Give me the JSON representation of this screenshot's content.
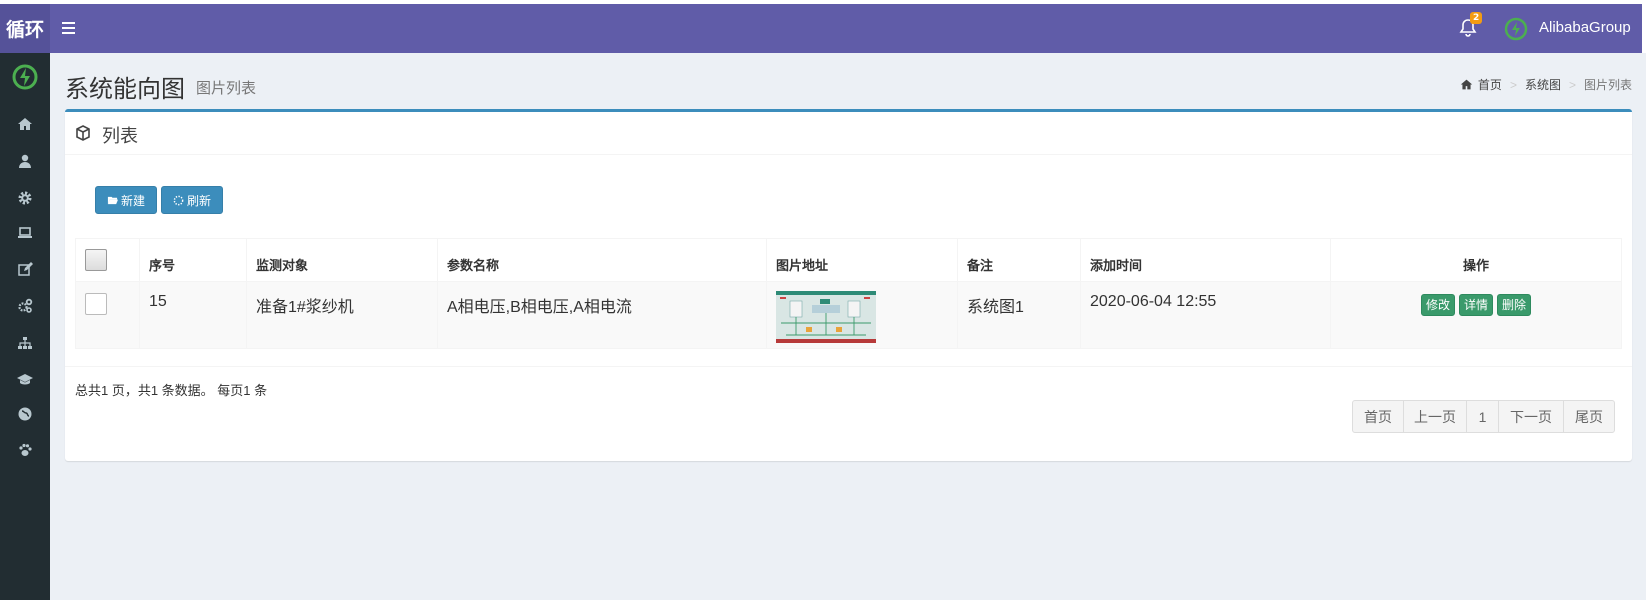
{
  "header": {
    "logo_text": "循环",
    "notification_count": "2",
    "user_name": "AlibabaGroup"
  },
  "sidebar": {
    "items": [
      {
        "icon": "home-icon"
      },
      {
        "icon": "user-icon"
      },
      {
        "icon": "gear-icon"
      },
      {
        "icon": "laptop-icon"
      },
      {
        "icon": "edit-icon"
      },
      {
        "icon": "gears-icon"
      },
      {
        "icon": "sitemap-icon"
      },
      {
        "icon": "graduation-cap-icon"
      },
      {
        "icon": "globe-icon"
      },
      {
        "icon": "paw-icon"
      }
    ]
  },
  "page": {
    "title": "系统能向图",
    "subtitle": "图片列表"
  },
  "breadcrumb": {
    "home": "首页",
    "level2": "系统图",
    "current": "图片列表"
  },
  "box": {
    "title": "列表",
    "new_label": "新建",
    "refresh_label": "刷新"
  },
  "table": {
    "headers": {
      "index": "序号",
      "target": "监测对象",
      "params": "参数名称",
      "image": "图片地址",
      "remark": "备注",
      "added": "添加时间",
      "actions": "操作"
    },
    "rows": [
      {
        "index": "15",
        "target": "准备1#浆纱机",
        "params": "A相电压,B相电压,A相电流",
        "remark": "系统图1",
        "added": "2020-06-04 12:55",
        "edit": "修改",
        "detail": "详情",
        "delete": "删除"
      }
    ]
  },
  "footer": {
    "summary": "总共1 页，共1 条数据。 每页1 条",
    "pager": {
      "first": "首页",
      "prev": "上一页",
      "current": "1",
      "next": "下一页",
      "last": "尾页"
    }
  },
  "colors": {
    "header": "#605ca8",
    "logo_bg": "#555299",
    "sidebar": "#222d32",
    "primary": "#3c8dbc",
    "success": "#3a9a6b",
    "badge": "#f39c12"
  }
}
